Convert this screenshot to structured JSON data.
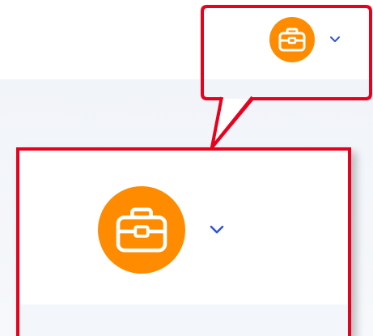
{
  "account_menu": {
    "avatar_icon": "briefcase-icon",
    "dropdown_icon": "chevron-down-icon",
    "avatar_color": "#ff8c00",
    "chevron_color": "#2f55d4"
  },
  "annotation": {
    "highlight_color": "#e8001c",
    "type": "zoom-callout"
  }
}
